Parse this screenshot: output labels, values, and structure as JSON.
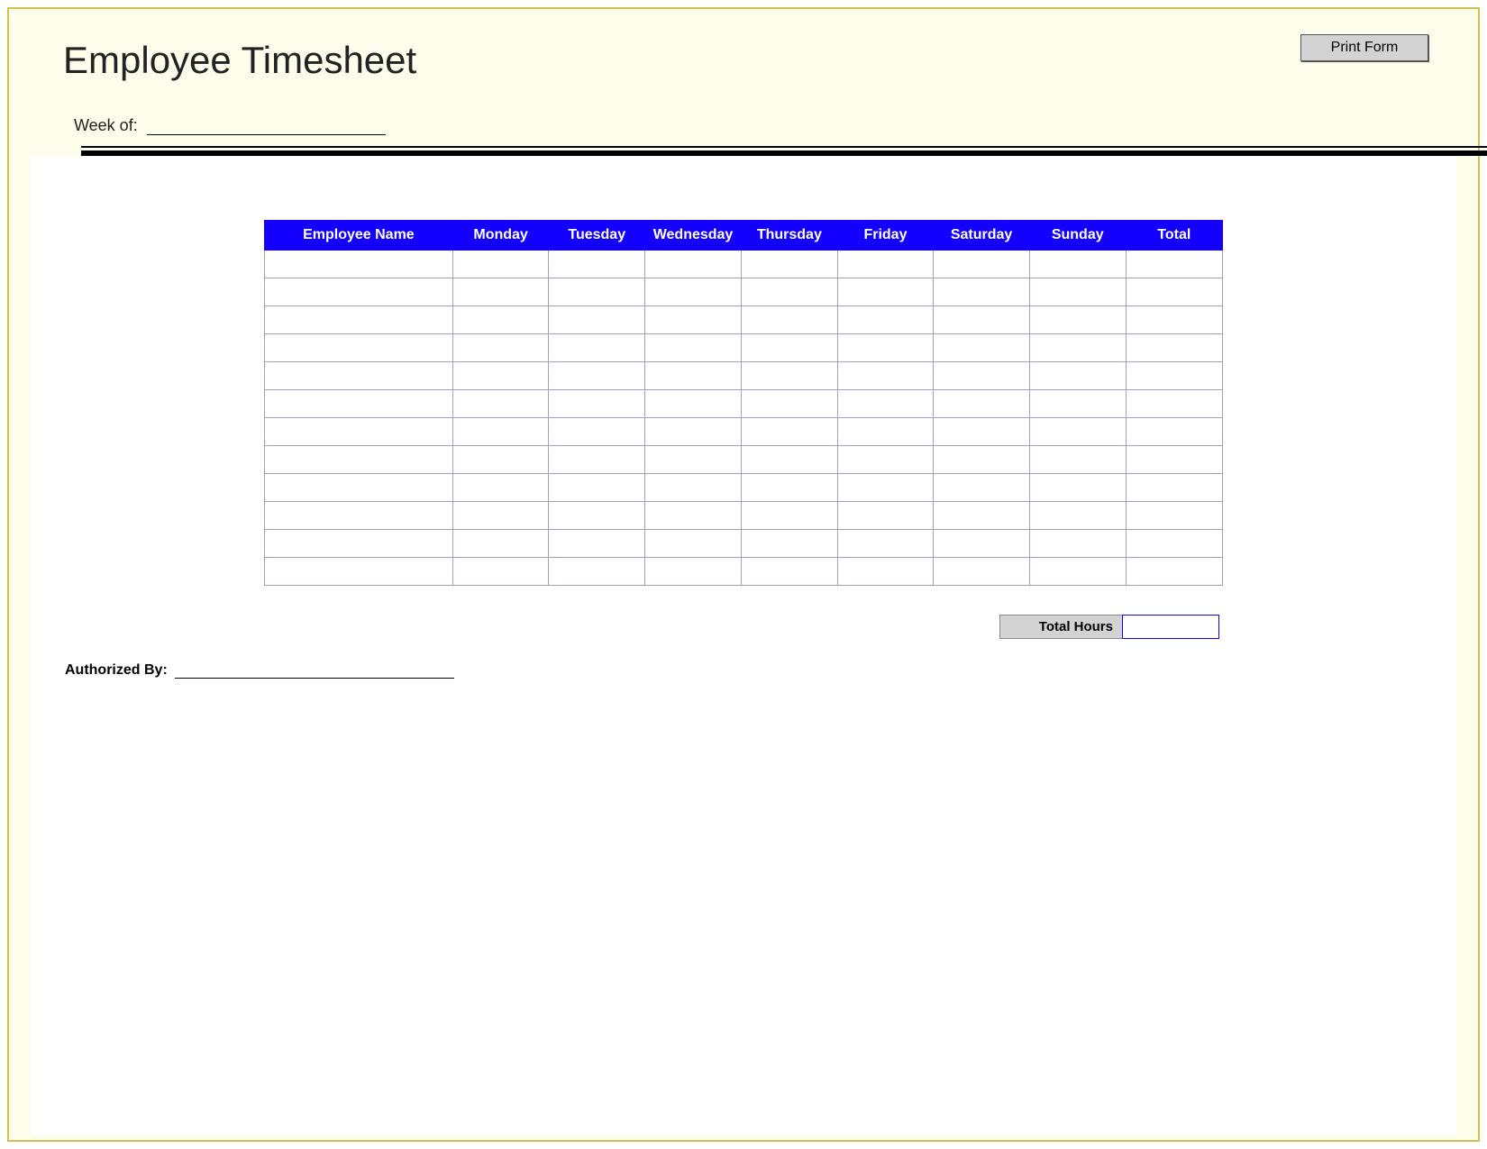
{
  "header": {
    "title": "Employee Timesheet",
    "print_button": "Print Form",
    "week_label": "Week of:",
    "week_value": ""
  },
  "table": {
    "headers": [
      "Employee Name",
      "Monday",
      "Tuesday",
      "Wednesday",
      "Thursday",
      "Friday",
      "Saturday",
      "Sunday",
      "Total"
    ],
    "rows": [
      [
        "",
        "",
        "",
        "",
        "",
        "",
        "",
        "",
        ""
      ],
      [
        "",
        "",
        "",
        "",
        "",
        "",
        "",
        "",
        ""
      ],
      [
        "",
        "",
        "",
        "",
        "",
        "",
        "",
        "",
        ""
      ],
      [
        "",
        "",
        "",
        "",
        "",
        "",
        "",
        "",
        ""
      ],
      [
        "",
        "",
        "",
        "",
        "",
        "",
        "",
        "",
        ""
      ],
      [
        "",
        "",
        "",
        "",
        "",
        "",
        "",
        "",
        ""
      ],
      [
        "",
        "",
        "",
        "",
        "",
        "",
        "",
        "",
        ""
      ],
      [
        "",
        "",
        "",
        "",
        "",
        "",
        "",
        "",
        ""
      ],
      [
        "",
        "",
        "",
        "",
        "",
        "",
        "",
        "",
        ""
      ],
      [
        "",
        "",
        "",
        "",
        "",
        "",
        "",
        "",
        ""
      ],
      [
        "",
        "",
        "",
        "",
        "",
        "",
        "",
        "",
        ""
      ],
      [
        "",
        "",
        "",
        "",
        "",
        "",
        "",
        "",
        ""
      ]
    ]
  },
  "footer": {
    "total_hours_label": "Total Hours",
    "total_hours_value": "",
    "authorized_label": "Authorized By:",
    "authorized_value": ""
  }
}
